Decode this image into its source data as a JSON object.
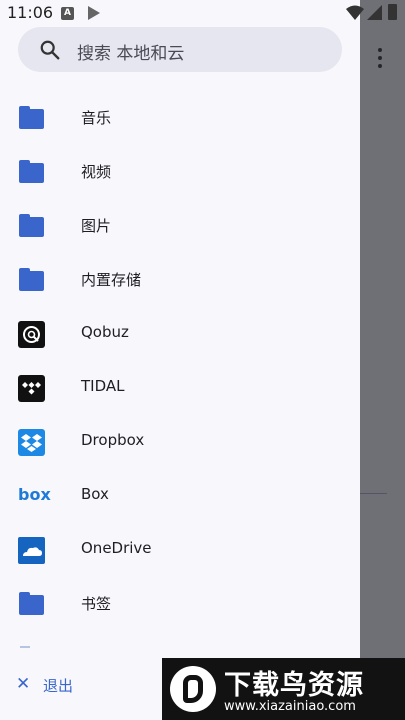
{
  "status_bar": {
    "time": "11:06",
    "a_badge": "A"
  },
  "search": {
    "placeholder": "搜索 本地和云"
  },
  "nav_items": [
    {
      "label": "音乐",
      "icon": "folder-icon"
    },
    {
      "label": "视频",
      "icon": "folder-icon"
    },
    {
      "label": "图片",
      "icon": "folder-icon"
    },
    {
      "label": "内置存储",
      "icon": "folder-icon"
    },
    {
      "label": "Qobuz",
      "icon": "qobuz-icon"
    },
    {
      "label": "TIDAL",
      "icon": "tidal-icon"
    },
    {
      "label": "Dropbox",
      "icon": "dropbox-icon"
    },
    {
      "label": "Box",
      "icon": "box-icon",
      "icon_text": "box"
    },
    {
      "label": "OneDrive",
      "icon": "onedrive-icon"
    },
    {
      "label": "书签",
      "icon": "folder-icon"
    }
  ],
  "footer": {
    "logout_label": "退出",
    "logout_icon": "close-icon"
  },
  "watermark": {
    "title": "下载鸟资源",
    "url": "www.xiazainiao.com"
  },
  "colors": {
    "accent": "#3a66cc",
    "drawer_bg": "#f8f8fc",
    "search_bg": "#e6e6f0",
    "scrim": "#6f6f76"
  }
}
